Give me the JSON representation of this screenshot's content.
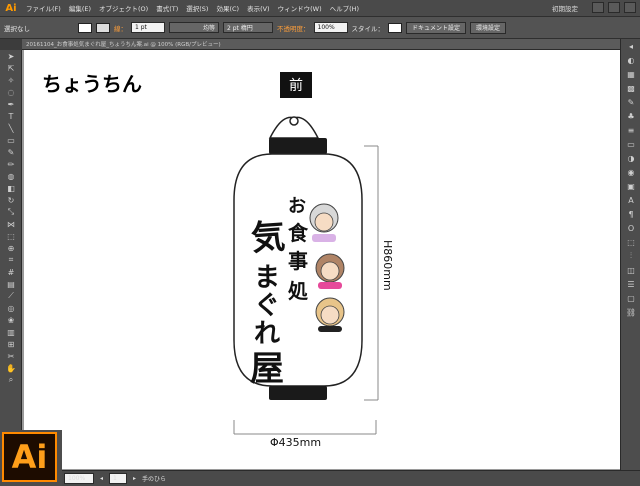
{
  "app": {
    "logo": "Ai",
    "workspace": "初期設定"
  },
  "menu": [
    "ファイル(F)",
    "編集(E)",
    "オブジェクト(O)",
    "書式(T)",
    "選択(S)",
    "効果(C)",
    "表示(V)",
    "ウィンドウ(W)",
    "ヘルプ(H)"
  ],
  "control": {
    "selection": "選択なし",
    "stroke_label": "線：",
    "stroke_value": "1 pt",
    "profile": "均等",
    "brush": "2 pt 楕円",
    "opacity_label": "不透明度：",
    "opacity_value": "100%",
    "style_label": "スタイル：",
    "doc_settings": "ドキュメント設定",
    "prefs": "環境設定"
  },
  "doc_tab": "20161104_お食事処気まぐれ屋_ちょうちん案.ai @ 100% (RGB/プレビュー)",
  "artboard": {
    "title": "ちょうちん",
    "front_label": "前",
    "height_dim": "H860mm",
    "width_dim": "Φ435mm",
    "lantern_text": "お食事処 気まぐれ屋"
  },
  "status": {
    "zoom": "100%",
    "page": "1",
    "tool": "手のひら"
  },
  "colors": {
    "accent": "#ff8a00",
    "lantern_black": "#1a1a1a"
  }
}
